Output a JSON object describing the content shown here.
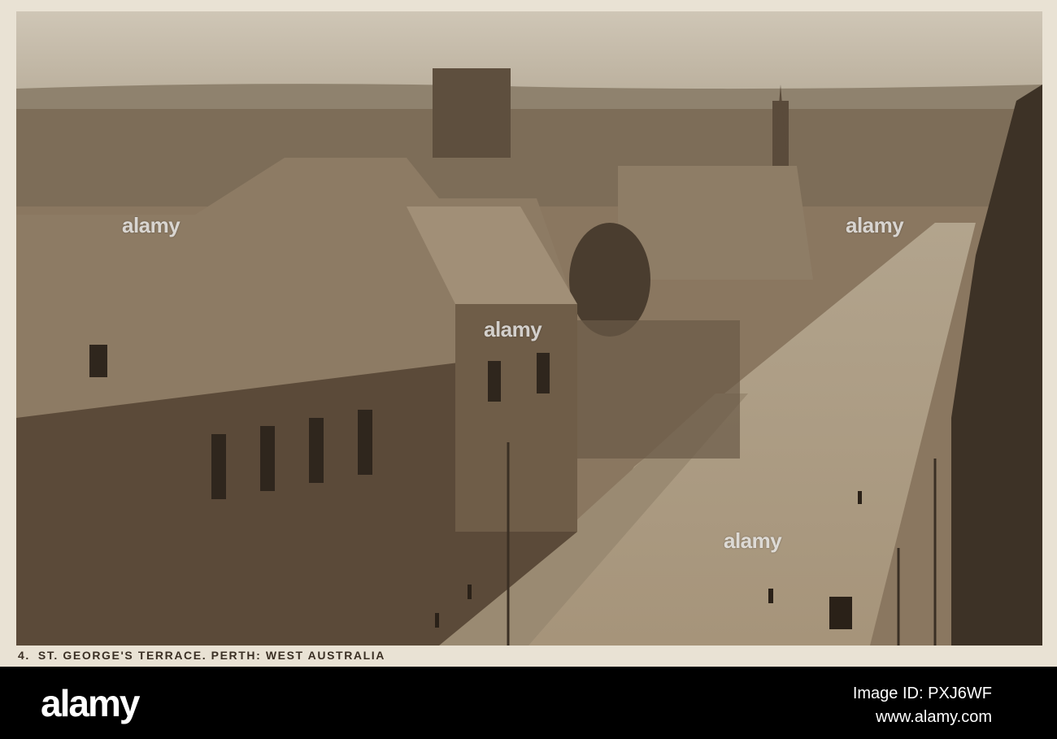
{
  "caption": {
    "number": "4.",
    "text": "ST. GEORGE'S TERRACE. PERTH: WEST AUSTRALIA"
  },
  "watermarks": [
    "alamy",
    "alamy",
    "alamy",
    "alamy"
  ],
  "footer": {
    "brand": "alamy",
    "image_id": "Image ID: PXJ6WF",
    "site": "www.alamy.com"
  },
  "colors": {
    "sepia_dark": "#3a2f24",
    "sepia_mid": "#8a7760",
    "sepia_light": "#d8cfbd",
    "postcard_border": "#e9e2d4"
  }
}
